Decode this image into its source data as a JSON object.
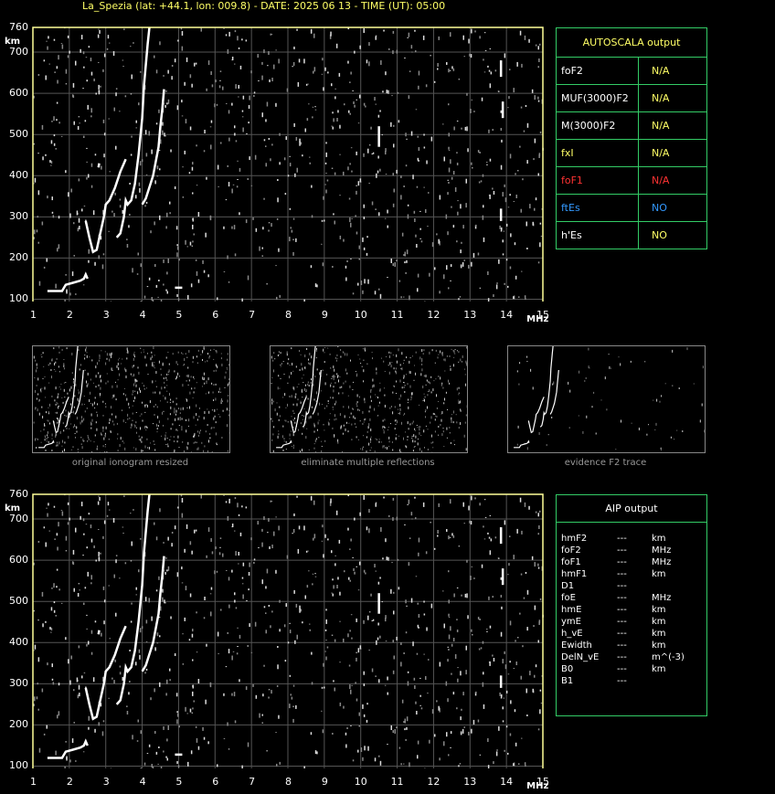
{
  "title": "La_Spezia (lat: +44.1, lon: 009.8) - DATE: 2025 06 13 - TIME (UT): 05:00",
  "axis": {
    "y_unit": "km",
    "x_unit": "MHz",
    "y_ticks": [
      "760",
      "700",
      "600",
      "500",
      "400",
      "300",
      "200",
      "100"
    ],
    "x_ticks": [
      "1",
      "2",
      "3",
      "4",
      "5",
      "6",
      "7",
      "8",
      "9",
      "10",
      "11",
      "12",
      "13",
      "14",
      "15"
    ]
  },
  "autoscala": {
    "header": "AUTOSCALA output",
    "rows": [
      {
        "key": "foF2",
        "value": "N/A",
        "key_color": "#ffffff",
        "value_color": "#ffff66"
      },
      {
        "key": "MUF(3000)F2",
        "value": "N/A",
        "key_color": "#ffffff",
        "value_color": "#ffff66"
      },
      {
        "key": "M(3000)F2",
        "value": "N/A",
        "key_color": "#ffffff",
        "value_color": "#ffff66"
      },
      {
        "key": "fxI",
        "value": "N/A",
        "key_color": "#ffff66",
        "value_color": "#ffff66"
      },
      {
        "key": "foF1",
        "value": "N/A",
        "key_color": "#ff3333",
        "value_color": "#ff3333"
      },
      {
        "key": "ftEs",
        "value": "NO",
        "key_color": "#3399ff",
        "value_color": "#3399ff"
      },
      {
        "key": "h'Es",
        "value": "NO",
        "key_color": "#ffffff",
        "value_color": "#ffff66"
      }
    ]
  },
  "thumbnails": [
    {
      "caption": "original ionogram resized"
    },
    {
      "caption": "eliminate multiple reflections"
    },
    {
      "caption": "evidence F2 trace"
    }
  ],
  "aip": {
    "header": "AIP output",
    "rows": [
      {
        "name": "hmF2",
        "value": "---",
        "unit": "km"
      },
      {
        "name": "foF2",
        "value": "---",
        "unit": "MHz"
      },
      {
        "name": "foF1",
        "value": "---",
        "unit": "MHz"
      },
      {
        "name": "hmF1",
        "value": "---",
        "unit": "km"
      },
      {
        "name": "D1",
        "value": "---",
        "unit": ""
      },
      {
        "name": "foE",
        "value": "---",
        "unit": "MHz"
      },
      {
        "name": "hmE",
        "value": "---",
        "unit": "km"
      },
      {
        "name": "ymE",
        "value": "---",
        "unit": "km"
      },
      {
        "name": "h_vE",
        "value": "---",
        "unit": "km"
      },
      {
        "name": "Ewidth",
        "value": "---",
        "unit": "km"
      },
      {
        "name": "DelN_vE",
        "value": "---",
        "unit": "m^(-3)"
      },
      {
        "name": "B0",
        "value": "---",
        "unit": "km"
      },
      {
        "name": "B1",
        "value": "---",
        "unit": ""
      }
    ]
  },
  "colors": {
    "frame": "#ffff99",
    "grid": "#555555",
    "panel_border": "#33cc66",
    "title": "#ffff66"
  }
}
